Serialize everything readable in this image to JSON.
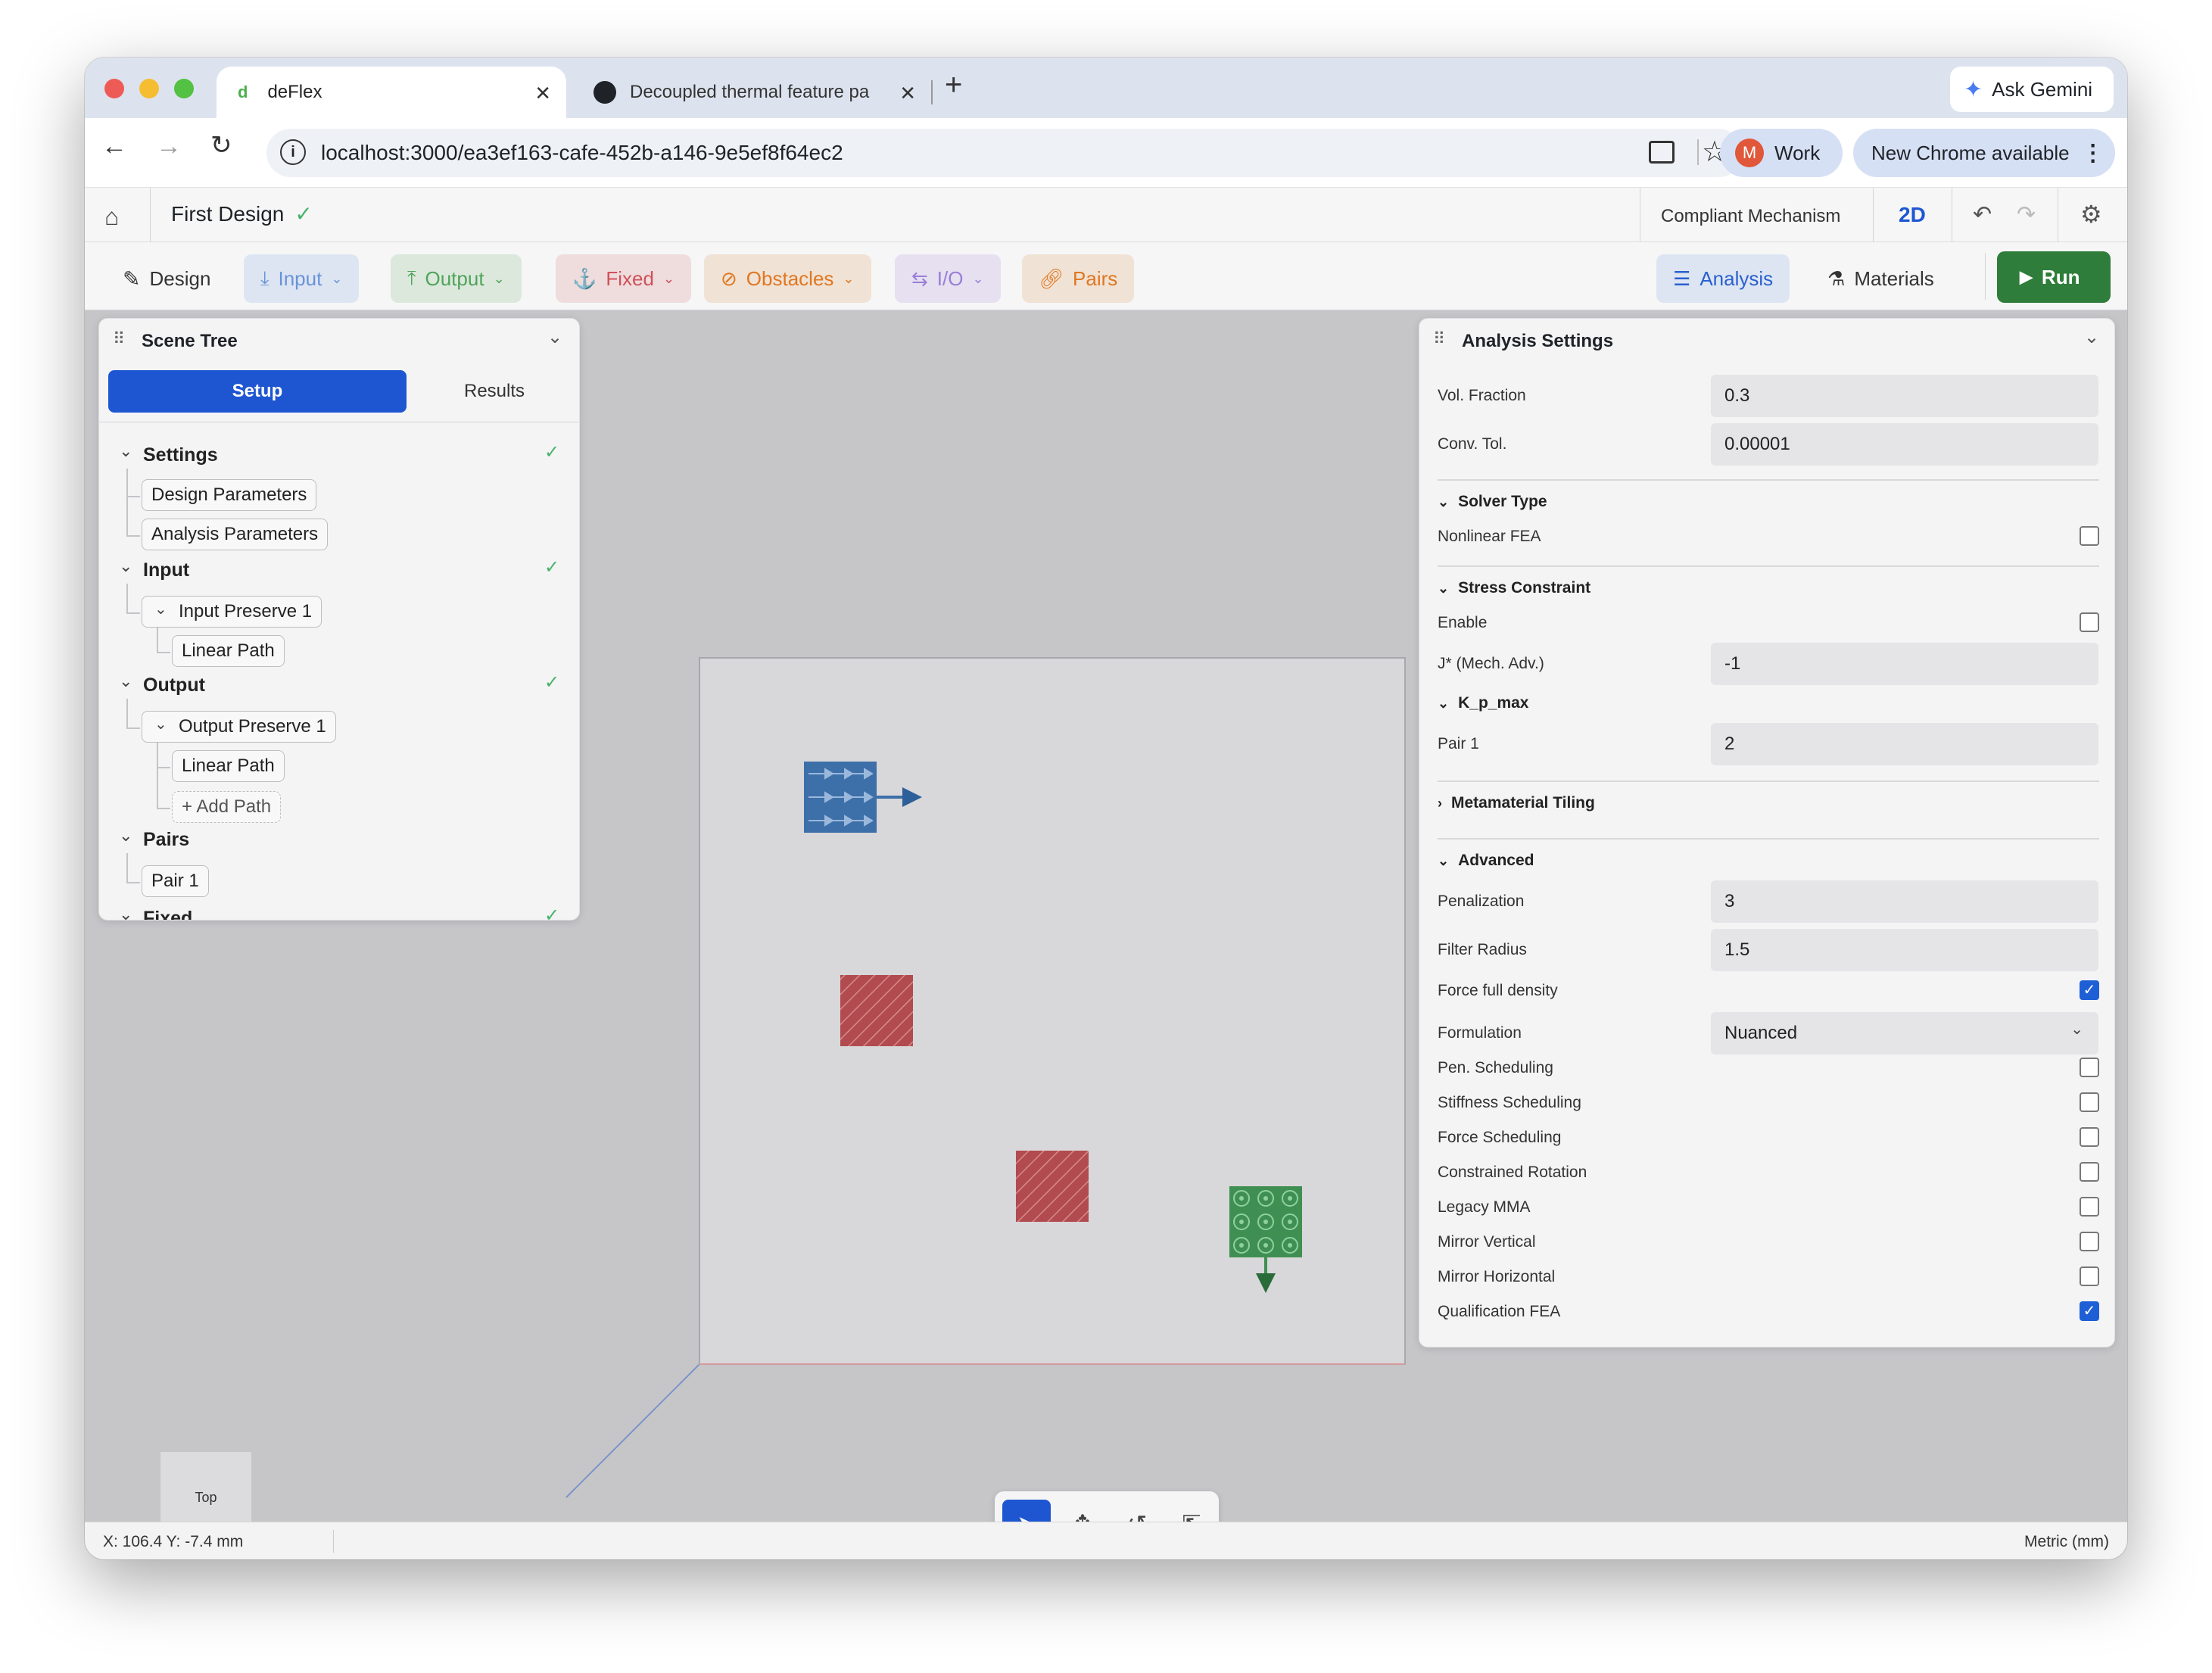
{
  "browser": {
    "tabs": [
      {
        "title": "deFlex",
        "favicon": "d"
      },
      {
        "title": "Decoupled thermal feature pa"
      }
    ],
    "url": "localhost:3000/ea3ef163-cafe-452b-a146-9e5ef8f64ec2",
    "ask_gemini": "Ask Gemini",
    "profile_initial": "M",
    "profile_label": "Work",
    "update_label": "New Chrome available"
  },
  "app": {
    "design_name": "First Design",
    "mode": "Compliant Mechanism",
    "dim": "2D"
  },
  "toolbar": {
    "design": "Design",
    "input": "Input",
    "output": "Output",
    "fixed": "Fixed",
    "obstacles": "Obstacles",
    "io": "I/O",
    "pairs": "Pairs",
    "analysis": "Analysis",
    "materials": "Materials",
    "run": "Run"
  },
  "scene_tree": {
    "title": "Scene Tree",
    "tabs": [
      "Setup",
      "Results"
    ],
    "settings": {
      "label": "Settings",
      "items": [
        "Design Parameters",
        "Analysis Parameters"
      ]
    },
    "input": {
      "label": "Input",
      "preserve": "Input Preserve 1",
      "path": "Linear Path"
    },
    "output": {
      "label": "Output",
      "preserve": "Output Preserve 1",
      "path": "Linear Path",
      "add": "+ Add Path"
    },
    "pairs": {
      "label": "Pairs",
      "items": [
        "Pair 1"
      ]
    },
    "fixed": {
      "label": "Fixed"
    }
  },
  "analysis": {
    "title": "Analysis Settings",
    "vol_fraction": {
      "label": "Vol. Fraction",
      "value": "0.3"
    },
    "conv_tol": {
      "label": "Conv. Tol.",
      "value": "0.00001"
    },
    "solver_type": "Solver Type",
    "nonlinear": {
      "label": "Nonlinear FEA",
      "checked": false
    },
    "stress": "Stress Constraint",
    "enable": {
      "label": "Enable",
      "checked": false
    },
    "jstar": {
      "label": "J* (Mech. Adv.)",
      "value": "-1"
    },
    "kpmax": "K_p_max",
    "pair1": {
      "label": "Pair 1",
      "value": "2"
    },
    "metamaterial": "Metamaterial Tiling",
    "advanced": "Advanced",
    "penalization": {
      "label": "Penalization",
      "value": "3"
    },
    "filter_radius": {
      "label": "Filter Radius",
      "value": "1.5"
    },
    "force_full": {
      "label": "Force full density",
      "checked": true
    },
    "formulation": {
      "label": "Formulation",
      "value": "Nuanced"
    },
    "checkboxes": [
      {
        "label": "Pen. Scheduling",
        "checked": false
      },
      {
        "label": "Stiffness Scheduling",
        "checked": false
      },
      {
        "label": "Force Scheduling",
        "checked": false
      },
      {
        "label": "Constrained Rotation",
        "checked": false
      },
      {
        "label": "Legacy MMA",
        "checked": false
      },
      {
        "label": "Mirror Vertical",
        "checked": false
      },
      {
        "label": "Mirror Horizontal",
        "checked": false
      },
      {
        "label": "Qualification FEA",
        "checked": true
      }
    ]
  },
  "viewport": {
    "view_cube": "Top"
  },
  "status": {
    "coords": "X: 106.4 Y: -7.4 mm",
    "units": "Metric (mm)"
  },
  "colors": {
    "accent": "#1e56d2",
    "run": "#2f7d3a",
    "input": "#3d6fa8",
    "obstacle": "#b24b4f",
    "output": "#3f8f52"
  }
}
